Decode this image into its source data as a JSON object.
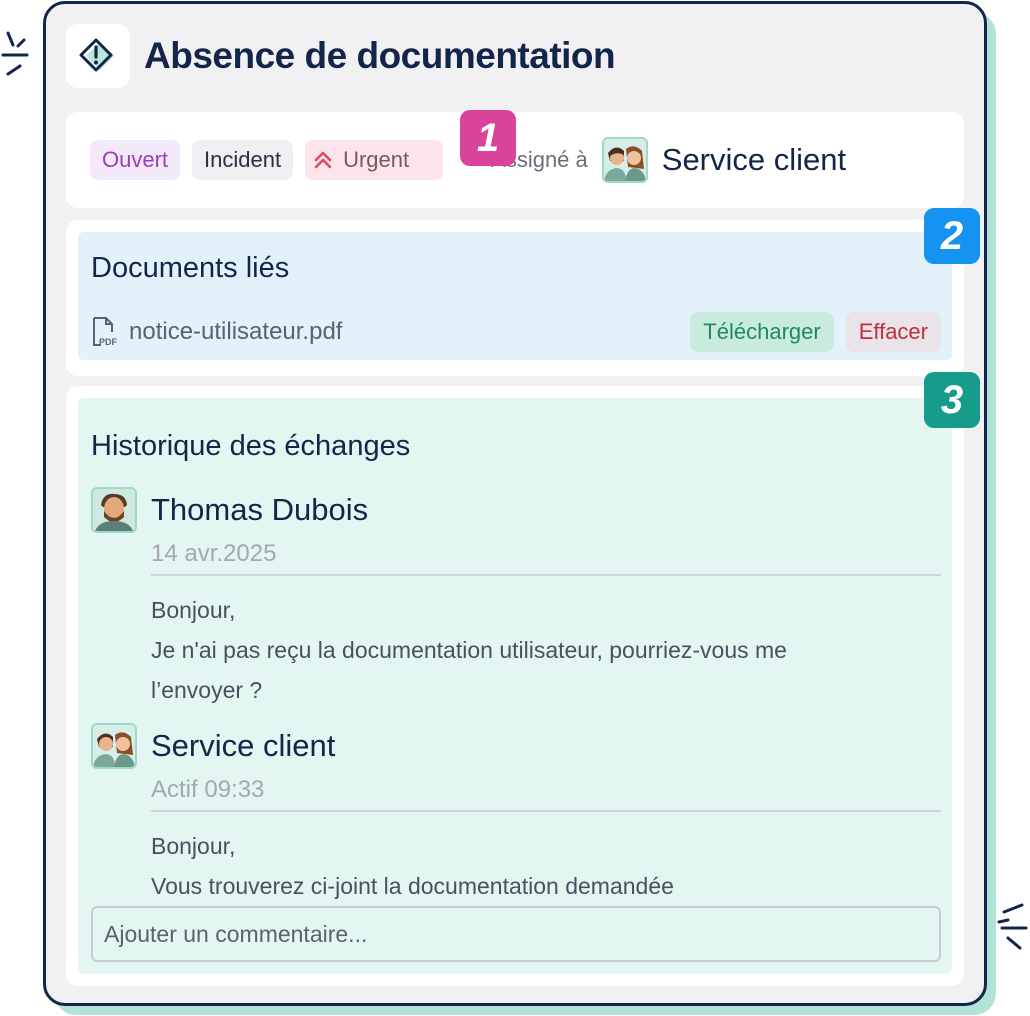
{
  "ticket": {
    "title": "Absence de documentation",
    "status": "Ouvert",
    "type": "Incident",
    "priority": "Urgent",
    "assigned_label": "Assigné à",
    "assignee": "Service client"
  },
  "badges": [
    "1",
    "2",
    "3"
  ],
  "documents": {
    "title": "Documents liés",
    "files": [
      {
        "name": "notice-utilisateur.pdf",
        "download_label": "Télécharger",
        "delete_label": "Effacer"
      }
    ]
  },
  "history": {
    "title": "Historique des échanges",
    "messages": [
      {
        "author": "Thomas Dubois",
        "time": "14 avr.2025",
        "lines": [
          "Bonjour,",
          "Je n'ai pas reçu la documentation utilisateur, pourriez-vous me",
          "l’envoyer ?"
        ]
      },
      {
        "author": "Service client",
        "time": "Actif 09:33",
        "lines": [
          "Bonjour,",
          "Vous trouverez ci-joint la documentation demandée"
        ]
      }
    ],
    "comment_placeholder": "Ajouter un commentaire..."
  },
  "icons": {
    "header": "diamond-alert-icon",
    "priority": "double-chevron-up-icon",
    "file": "pdf-file-icon"
  },
  "colors": {
    "navy": "#13264a",
    "badge_1": "#d9449a",
    "badge_2": "#1493f0",
    "badge_3": "#179b8a",
    "open_tag": "#9a3fb5",
    "download": "#1f8a5c",
    "delete": "#c0303c"
  }
}
